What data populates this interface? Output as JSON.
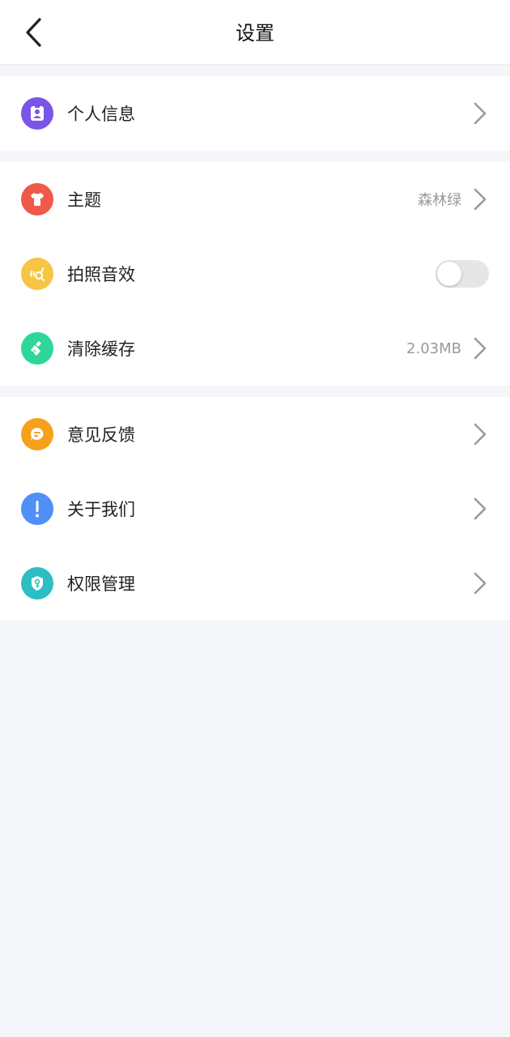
{
  "header": {
    "title": "设置"
  },
  "groups": [
    {
      "items": [
        {
          "label": "个人信息",
          "icon": "person-card-icon",
          "color": "#7b55e8"
        }
      ]
    },
    {
      "items": [
        {
          "label": "主题",
          "icon": "tshirt-icon",
          "color": "#f0584a",
          "value": "森林绿"
        },
        {
          "label": "拍照音效",
          "icon": "sound-icon",
          "color": "#f6c544",
          "toggle": false
        },
        {
          "label": "清除缓存",
          "icon": "broom-icon",
          "color": "#2fd69a",
          "value": "2.03MB"
        }
      ]
    },
    {
      "items": [
        {
          "label": "意见反馈",
          "icon": "feedback-icon",
          "color": "#f7a01c"
        },
        {
          "label": "关于我们",
          "icon": "exclamation-icon",
          "color": "#4f8ff7"
        },
        {
          "label": "权限管理",
          "icon": "shield-key-icon",
          "color": "#2bbfc4"
        }
      ]
    }
  ]
}
